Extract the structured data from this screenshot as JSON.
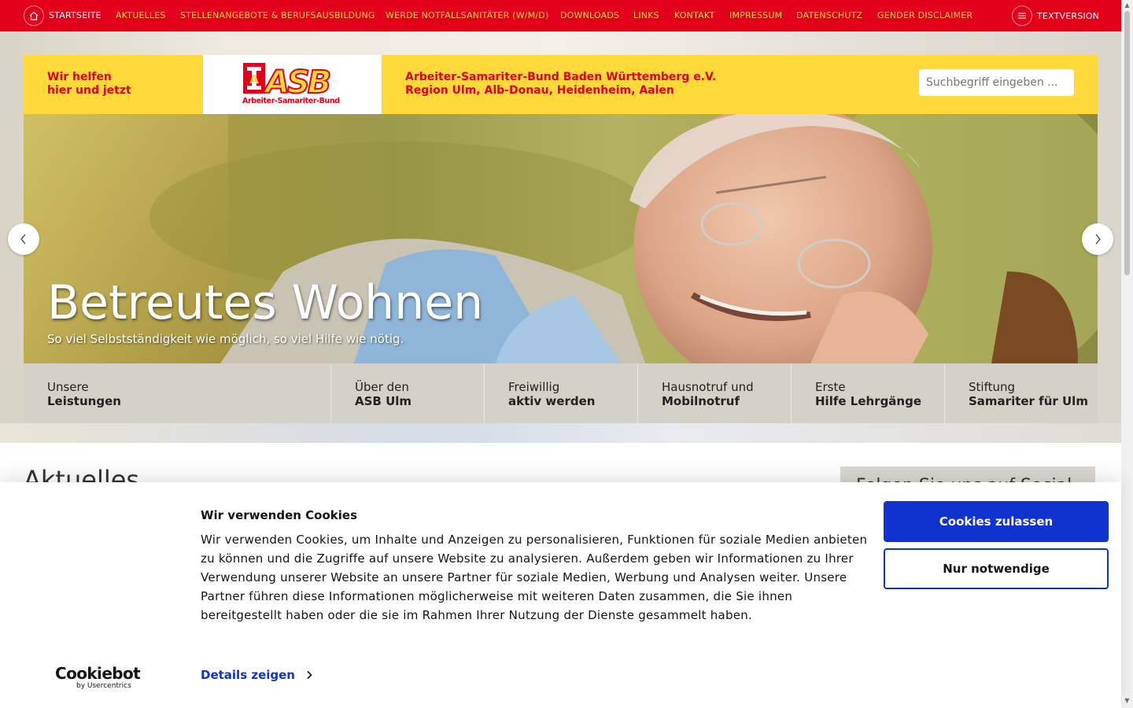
{
  "nav": {
    "home_label": "STARTSEITE",
    "items": [
      "AKTUELLES",
      "STELLENANGEBOTE & BERUFSAUSBILDUNG",
      "WERDE NOTFALLSANITÄTER (W/M/D)",
      "DOWNLOADS",
      "LINKS",
      "KONTAKT",
      "IMPRESSUM",
      "DATENSCHUTZ",
      "GENDER DISCLAIMER"
    ],
    "textversion_label": "TEXTVERSION"
  },
  "header": {
    "tagline_line1": "Wir helfen",
    "tagline_line2": "hier und jetzt",
    "logo_text": "ASB",
    "logo_subtitle": "Arbeiter-Samariter-Bund",
    "org_line1": "Arbeiter-Samariter-Bund Baden Württemberg e.V.",
    "org_line2": "Region Ulm, Alb-Donau, Heidenheim, Aalen",
    "search_placeholder": "Suchbegriff eingeben ..."
  },
  "hero": {
    "title": "Betreutes Wohnen",
    "subtitle": "So viel Selbstständigkeit wie möglich, so viel Hilfe wie nötig."
  },
  "quick_links": [
    {
      "line1": "Unsere",
      "line2": "Leistungen"
    },
    {
      "line1": "Über den",
      "line2": "ASB Ulm"
    },
    {
      "line1": "Freiwillig",
      "line2": "aktiv werden"
    },
    {
      "line1": "Hausnotruf und",
      "line2": "Mobilnotruf"
    },
    {
      "line1": "Erste",
      "line2": "Hilfe Lehrgänge"
    },
    {
      "line1": "Stiftung",
      "line2": "Samariter für Ulm"
    }
  ],
  "content": {
    "section_title": "Aktuelles",
    "social_title": "Folgen Sie uns auf Social"
  },
  "cookie": {
    "title": "Wir verwenden Cookies",
    "text": "Wir verwenden Cookies, um Inhalte und Anzeigen zu personalisieren, Funktionen für soziale Medien anbieten zu können und die Zugriffe auf unsere Website zu analysieren. Außerdem geben wir Informationen zu Ihrer Verwendung unserer Website an unsere Partner für soziale Medien, Werbung und Analysen weiter. Unsere Partner führen diese Informationen möglicherweise mit weiteren Daten zusammen, die Sie ihnen bereitgestellt haben oder die sie im Rahmen Ihrer Nutzung der Dienste gesammelt haben.",
    "details_label": "Details zeigen",
    "allow_label": "Cookies zulassen",
    "necessary_label": "Nur notwendige",
    "brand_name": "Cookiebot",
    "brand_by": "by Usercentrics"
  },
  "colors": {
    "brand_red": "#e2001a",
    "brand_yellow": "#ffd83a",
    "nav_link": "#ffd84a",
    "cookie_blue": "#1032cf"
  },
  "icons": {
    "home": "home-icon",
    "textversion": "list-icon",
    "slider_prev": "chevron-left-icon",
    "slider_next": "chevron-right-icon",
    "details": "chevron-right-icon"
  }
}
